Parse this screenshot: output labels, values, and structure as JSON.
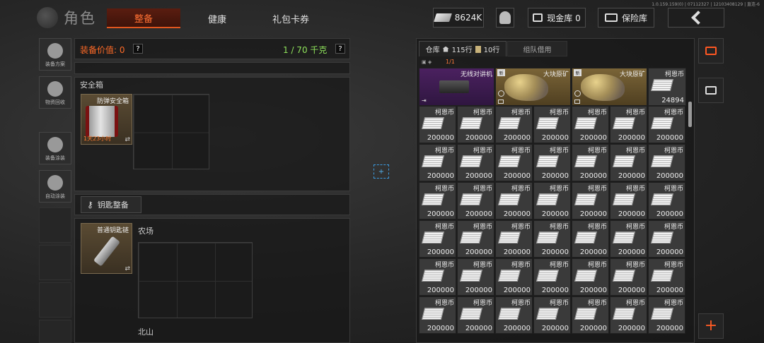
{
  "debug_info": "1.0.159.159(0) | 07112327 | 12103408129 | 直连-6",
  "header": {
    "title": "角色",
    "tabs": [
      {
        "label": "整备",
        "active": true
      },
      {
        "label": "健康",
        "active": false
      },
      {
        "label": "礼包卡券",
        "active": false
      }
    ],
    "money": "8624K",
    "cash_vault": "现金库 0",
    "safe_vault": "保险库"
  },
  "sidebar": {
    "items": [
      {
        "label": "装备方案",
        "icon": "gear-plan-icon"
      },
      {
        "label": "物资回收",
        "icon": "recycle-icon"
      },
      {
        "label": "装备涂装",
        "icon": "helmet-paint-icon"
      },
      {
        "label": "自动涂装",
        "icon": "auto-paint-icon"
      }
    ]
  },
  "loadout": {
    "value_label": "装备价值: 0",
    "weight_label": "1 / 70 千克",
    "help": "?",
    "safe_box": {
      "title": "安全箱",
      "item_name": "防弹安全箱",
      "timer": "1天23小时"
    },
    "key_section": {
      "button_label": "钥匙整备",
      "item_name": "普通钥匙链",
      "map_farm": "农场",
      "map_north": "北山"
    }
  },
  "warehouse": {
    "tab_label": "仓库",
    "rows_house": "115行",
    "rows_extra": "10行",
    "team_borrow": "组队借用",
    "row_count": "1/1",
    "top_row": [
      {
        "name": "无线对讲机",
        "type": "radio",
        "span": 2
      },
      {
        "name": "大块原矿",
        "type": "ore",
        "span": 2,
        "new": true
      },
      {
        "name": "大块原矿",
        "type": "ore",
        "span": 2,
        "new": true
      },
      {
        "name": "柯恩币",
        "type": "coin",
        "span": 1,
        "qty": "24894"
      }
    ],
    "coin_name": "柯恩币",
    "coin_qty": "200000",
    "grid_rows": 6,
    "grid_cols": 7
  },
  "colors": {
    "accent": "#ff6a26",
    "weight_green": "#8fe35b",
    "gold_rarity": "#7a6437",
    "purple_rarity": "#4b2160"
  }
}
